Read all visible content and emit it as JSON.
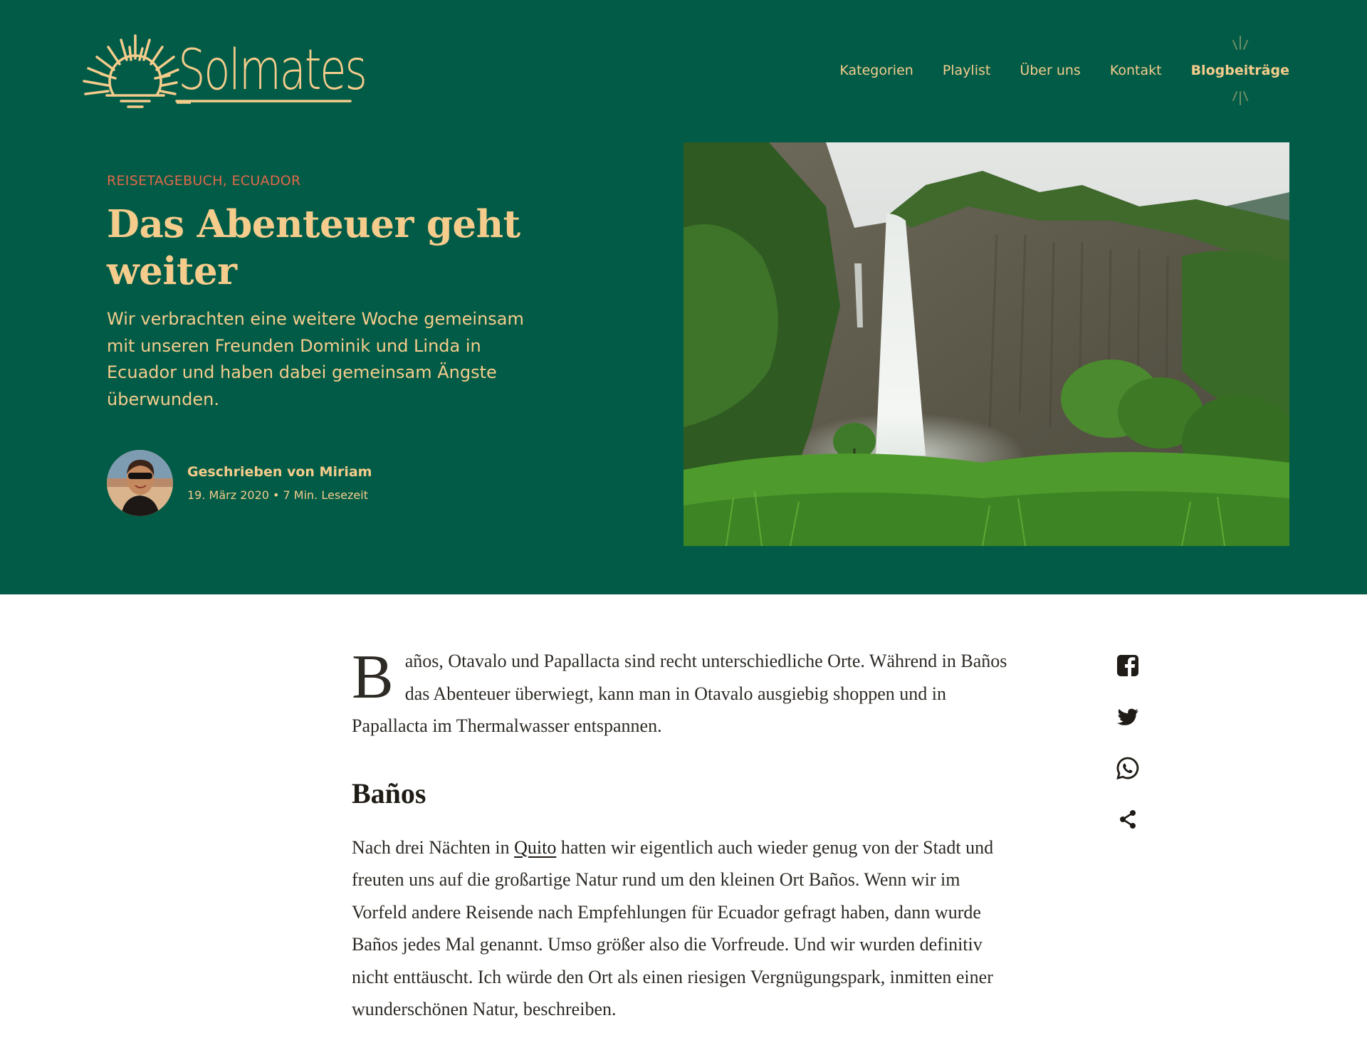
{
  "brand": {
    "name": "Solmates"
  },
  "nav": {
    "items": [
      "Kategorien",
      "Playlist",
      "Über uns",
      "Kontakt",
      "Blogbeiträge"
    ],
    "active": "Blogbeiträge"
  },
  "hero": {
    "kicker": "REISETAGEBUCH, ECUADOR",
    "title": "Das Abenteuer geht weiter",
    "lede": "Wir verbrachten eine weitere Woche gemeinsam mit unseren Freunden Dominik und Linda in Ecuador und haben dabei gemeinsam Ängste überwunden.",
    "author": "Geschrieben von Miriam",
    "meta": "19. März 2020 • 7 Min. Lesezeit"
  },
  "article": {
    "intro_dropcap": "B",
    "intro_rest": "años, Otavalo und Papallacta sind recht unterschiedliche Orte. Während in Baños das Abenteuer überwiegt, kann man in Otavalo ausgiebig shoppen und in Papallacta im Thermalwasser entspannen.",
    "section_heading": "Baños",
    "p2_before": "Nach drei Nächten in ",
    "p2_link": "Quito",
    "p2_after": " hatten wir eigentlich auch wieder genug von der Stadt und freuten uns auf die großartige Natur rund um den kleinen Ort Baños. Wenn wir im Vorfeld andere Reisende nach Empfehlungen für Ecuador gefragt haben, dann wurde Baños jedes Mal genannt. Umso größer also die Vorfreude. Und wir wurden definitiv nicht enttäuscht. Ich würde den Ort als einen riesigen Vergnügungspark, inmitten einer wunderschönen Natur, beschreiben."
  },
  "share": [
    "facebook-icon",
    "twitter-icon",
    "whatsapp-icon",
    "share-icon"
  ],
  "colors": {
    "hero_bg": "#015b46",
    "accent": "#f5cc8c",
    "kicker": "#e2684a",
    "text": "#2e2a25"
  }
}
